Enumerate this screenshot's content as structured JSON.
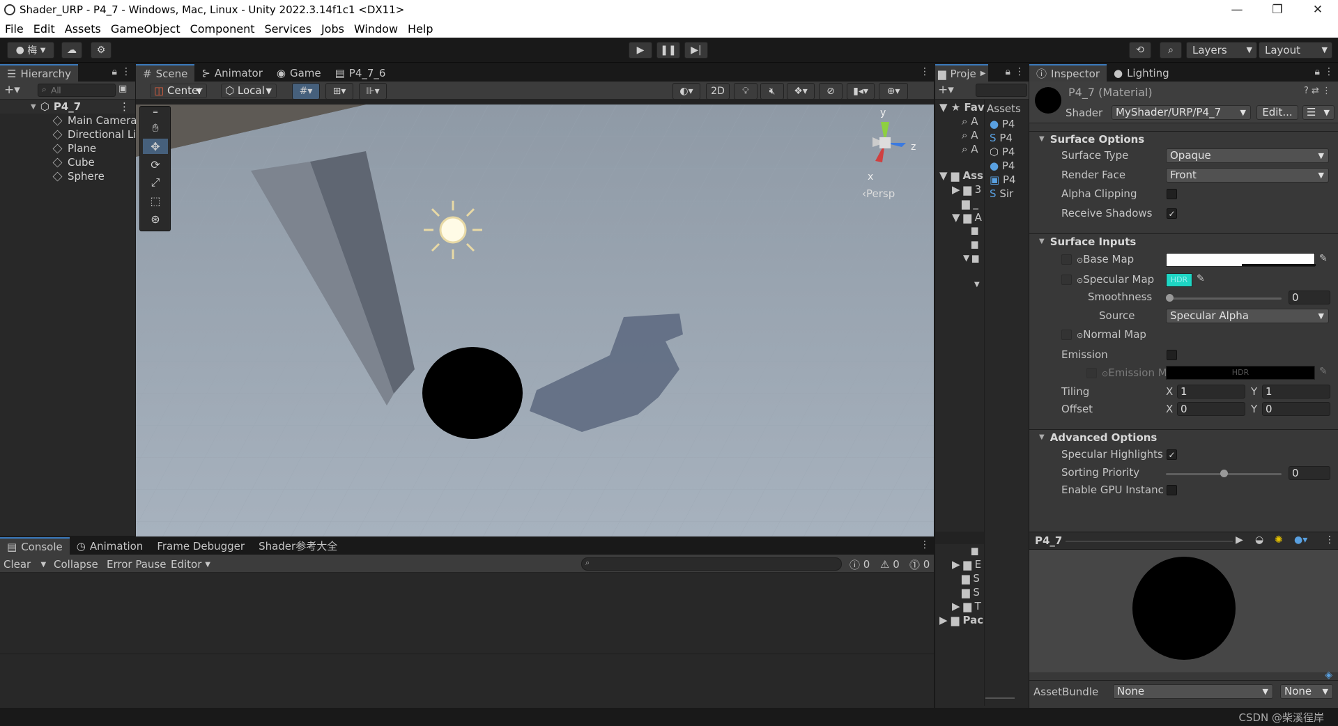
{
  "window": {
    "title": "Shader_URP - P4_7 - Windows, Mac, Linux - Unity 2022.3.14f1c1 <DX11>",
    "minimize": "—",
    "maximize": "❐",
    "close": "✕"
  },
  "menu": [
    "File",
    "Edit",
    "Assets",
    "GameObject",
    "Component",
    "Services",
    "Jobs",
    "Window",
    "Help"
  ],
  "toolbar": {
    "account": "梅",
    "layers": "Layers",
    "layout": "Layout"
  },
  "hierarchy": {
    "tab": "Hierarchy",
    "search_placeholder": "All",
    "root": "P4_7",
    "items": [
      "Main Camera",
      "Directional Li",
      "Plane",
      "Cube",
      "Sphere"
    ]
  },
  "scene": {
    "tabs": [
      "Scene",
      "Animator",
      "Game",
      "P4_7_6"
    ],
    "pivot": "Center",
    "space": "Local",
    "mode2d": "2D",
    "persp": "‹Persp",
    "gizmo": {
      "x": "x",
      "y": "y",
      "z": "z"
    }
  },
  "project": {
    "tab": "Proje",
    "favorites": "Fav",
    "assets_header": "Assets",
    "assets_root": "Ass",
    "fav_items": [
      "A",
      "A",
      "A"
    ],
    "asset_items": [
      "P4",
      "P4",
      "P4",
      "P4",
      "P4",
      "Sir"
    ],
    "folders": [
      "3",
      "_",
      "A"
    ],
    "lower_folders": [
      "E",
      "S",
      "S",
      "T"
    ],
    "packages": "Pac"
  },
  "inspector": {
    "tabs": [
      "Inspector",
      "Lighting"
    ],
    "material": "P4_7 (Material)",
    "shader_label": "Shader",
    "shader": "MyShader/URP/P4_7",
    "edit": "Edit...",
    "surface_options": {
      "header": "Surface Options",
      "surface_type_label": "Surface Type",
      "surface_type": "Opaque",
      "render_face_label": "Render Face",
      "render_face": "Front",
      "alpha_clipping_label": "Alpha Clipping",
      "alpha_clipping": false,
      "receive_shadows_label": "Receive Shadows",
      "receive_shadows": true
    },
    "surface_inputs": {
      "header": "Surface Inputs",
      "base_map": "Base Map",
      "specular_map": "Specular Map",
      "hdr": "HDR",
      "smoothness_label": "Smoothness",
      "smoothness": "0",
      "source_label": "Source",
      "source": "Specular Alpha",
      "normal_map": "Normal Map",
      "emission_label": "Emission",
      "emission_map": "Emission M",
      "tiling_label": "Tiling",
      "tiling_x": "1",
      "tiling_y": "1",
      "offset_label": "Offset",
      "offset_x": "0",
      "offset_y": "0",
      "x": "X",
      "y": "Y"
    },
    "advanced": {
      "header": "Advanced Options",
      "specular_highlights_label": "Specular Highlights",
      "specular_highlights": true,
      "sorting_priority_label": "Sorting Priority",
      "sorting_priority": "0",
      "gpu_instancing_label": "Enable GPU Instancir",
      "gpu_instancing": false
    },
    "preview_title": "P4_7",
    "assetbundle_label": "AssetBundle",
    "assetbundle": "None",
    "assetbundle_variant": "None"
  },
  "console": {
    "tabs": [
      "Console",
      "Animation",
      "Frame Debugger",
      "Shader参考大全"
    ],
    "clear": "Clear",
    "collapse": "Collapse",
    "error_pause": "Error Pause",
    "editor": "Editor",
    "count_log": "0",
    "count_warn": "0",
    "count_err": "0"
  },
  "watermark": "CSDN @柴溪徎岸"
}
